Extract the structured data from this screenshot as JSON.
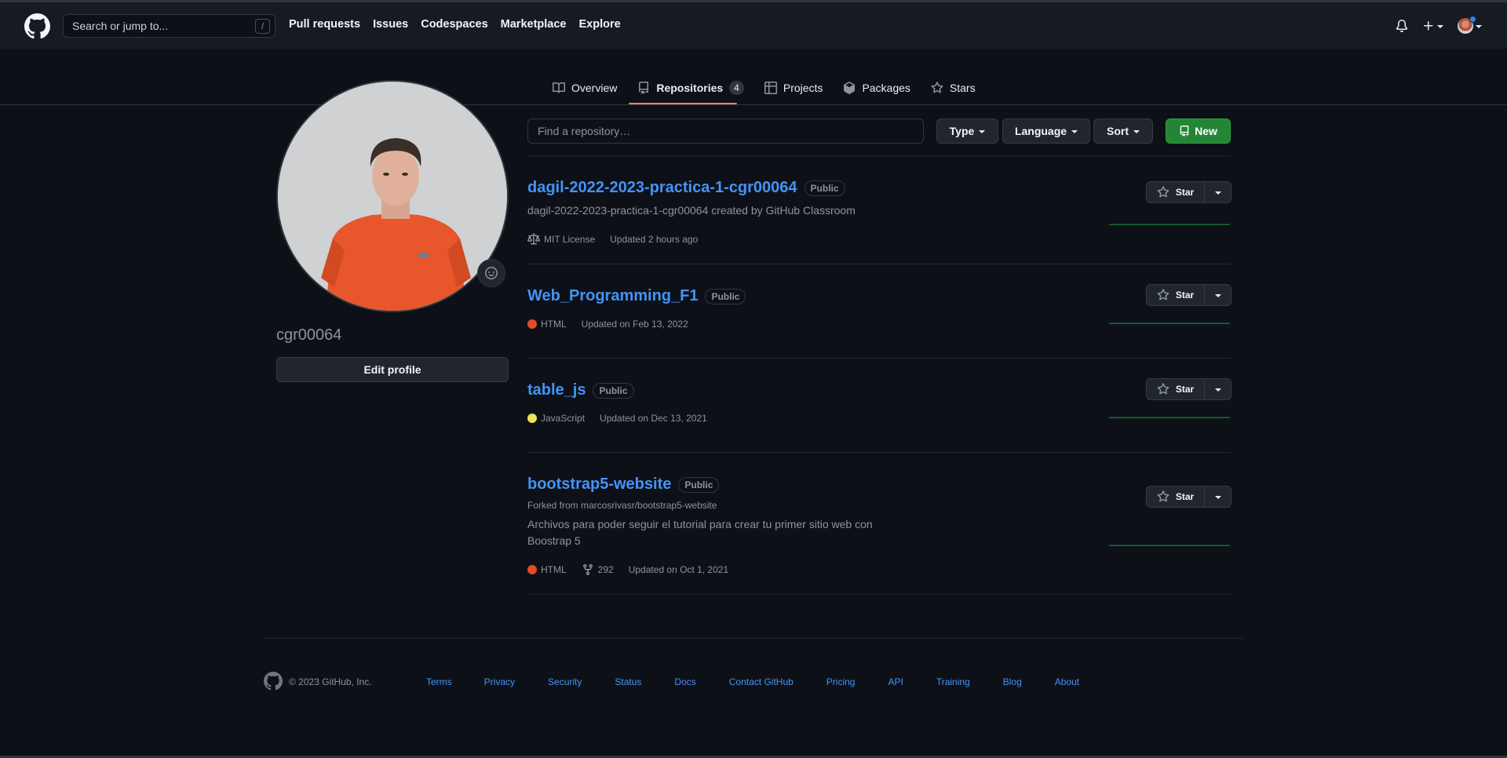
{
  "header": {
    "search_placeholder": "Search or jump to...",
    "search_shortcut": "/",
    "nav": [
      "Pull requests",
      "Issues",
      "Codespaces",
      "Marketplace",
      "Explore"
    ]
  },
  "profile_tabs": [
    {
      "label": "Overview",
      "icon": "book-icon"
    },
    {
      "label": "Repositories",
      "icon": "repo-icon",
      "count": "4"
    },
    {
      "label": "Projects",
      "icon": "table-icon"
    },
    {
      "label": "Packages",
      "icon": "package-icon"
    },
    {
      "label": "Stars",
      "icon": "star-icon"
    }
  ],
  "sidebar": {
    "username": "cgr00064",
    "edit_profile_label": "Edit profile"
  },
  "filters": {
    "find_placeholder": "Find a repository…",
    "type_label": "Type",
    "language_label": "Language",
    "sort_label": "Sort",
    "new_label": "New"
  },
  "repos": [
    {
      "name": "dagil-2022-2023-practica-1-cgr00064",
      "visibility": "Public",
      "description": "dagil-2022-2023-practica-1-cgr00064 created by GitHub Classroom",
      "license": "MIT License",
      "updated": "Updated 2 hours ago",
      "star_label": "Star"
    },
    {
      "name": "Web_Programming_F1",
      "visibility": "Public",
      "language": "HTML",
      "language_color": "#e34c26",
      "updated": "Updated on Feb 13, 2022",
      "star_label": "Star"
    },
    {
      "name": "table_js",
      "visibility": "Public",
      "language": "JavaScript",
      "language_color": "#f1e05a",
      "updated": "Updated on Dec 13, 2021",
      "star_label": "Star"
    },
    {
      "name": "bootstrap5-website",
      "visibility": "Public",
      "forked_from": "Forked from marcosrivasr/bootstrap5-website",
      "description_line1": "Archivos para poder seguir el tutorial para crear tu primer sitio web con",
      "description_line2": "Boostrap 5",
      "language": "HTML",
      "language_color": "#e34c26",
      "forks": "292",
      "updated": "Updated on Oct 1, 2021",
      "star_label": "Star"
    }
  ],
  "footer": {
    "copyright": "© 2023 GitHub, Inc.",
    "links": [
      "Terms",
      "Privacy",
      "Security",
      "Status",
      "Docs",
      "Contact GitHub",
      "Pricing",
      "API",
      "Training",
      "Blog",
      "About"
    ]
  },
  "colors": {
    "background": "#0d1117",
    "header": "#161b22",
    "link": "#4493f8",
    "accent_tab": "#f78166",
    "primary_button": "#238636"
  }
}
